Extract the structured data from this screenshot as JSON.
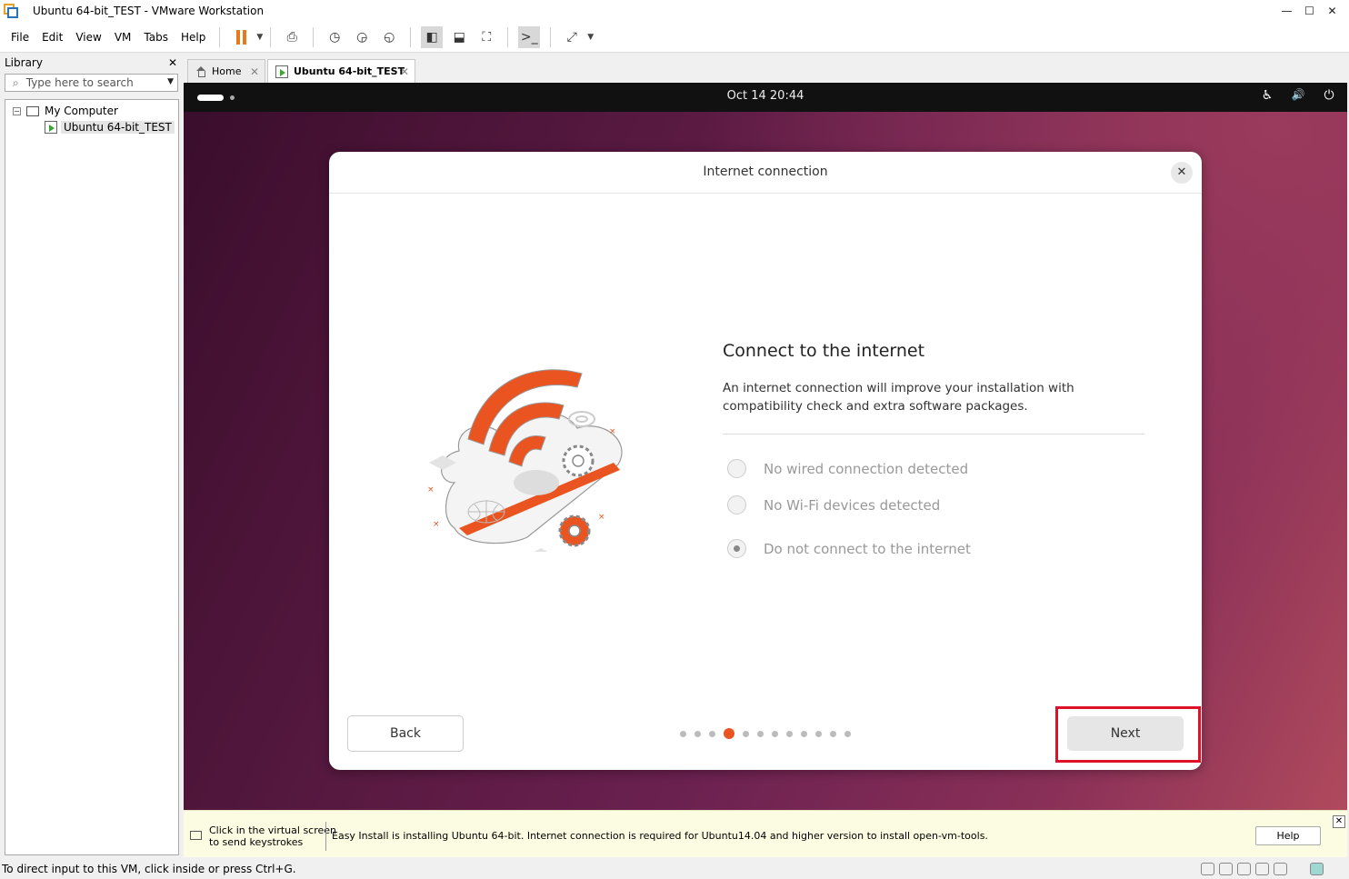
{
  "window": {
    "title": "Ubuntu 64-bit_TEST - VMware Workstation",
    "controls": [
      "—",
      "☐",
      "✕"
    ]
  },
  "menu": [
    "File",
    "Edit",
    "View",
    "VM",
    "Tabs",
    "Help"
  ],
  "library": {
    "title": "Library",
    "close": "✕",
    "search_placeholder": "Type here to search",
    "tree": {
      "root": "My Computer",
      "child": "Ubuntu 64-bit_TEST",
      "toggle": "−"
    }
  },
  "tabs": [
    {
      "label": "Home",
      "close": "✕"
    },
    {
      "label": "Ubuntu 64-bit_TEST",
      "close": "✕"
    }
  ],
  "guest": {
    "clock": "Oct 14  20:44",
    "tray": [
      "♿",
      "🔊",
      "⏻"
    ],
    "dialog": {
      "title": "Internet connection",
      "close": "✕",
      "heading": "Connect to the internet",
      "description": "An internet connection will improve your installation with compatibility check and extra software packages.",
      "options": [
        {
          "label": "No wired connection detected",
          "checked": false
        },
        {
          "label": "No Wi-Fi devices detected",
          "checked": false
        },
        {
          "label": "Do not connect to the internet",
          "checked": true
        }
      ],
      "back_label": "Back",
      "next_label": "Next",
      "progress": {
        "current": 4,
        "total": 12
      }
    }
  },
  "install_bar": {
    "hint_line1": "Click in the virtual screen",
    "hint_line2": "to send keystrokes",
    "message": "Easy Install is installing Ubuntu 64-bit. Internet connection is required for Ubuntu14.04 and higher version to install open-vm-tools.",
    "help_label": "Help",
    "close": "✕"
  },
  "status": {
    "text": "To direct input to this VM, click inside or press Ctrl+G."
  },
  "colors": {
    "accent": "#e95420",
    "highlight_box": "#e0102a",
    "pause": "#e57a1c"
  }
}
